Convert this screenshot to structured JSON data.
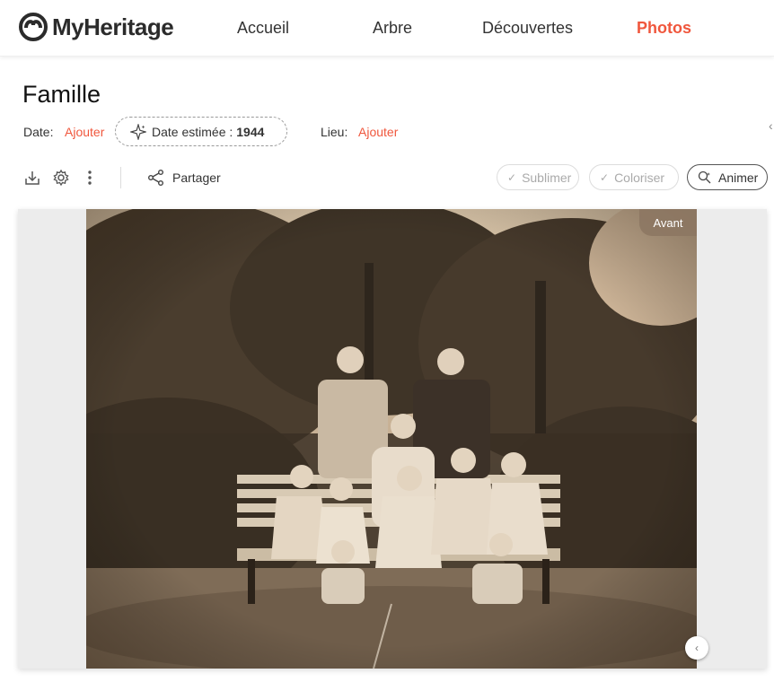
{
  "header": {
    "brand": "MyHeritage",
    "nav": [
      {
        "label": "Accueil",
        "active": false
      },
      {
        "label": "Arbre",
        "active": false
      },
      {
        "label": "Découvertes",
        "active": false
      },
      {
        "label": "Photos",
        "active": true
      }
    ],
    "accent_color": "#f0573d"
  },
  "photo_info": {
    "title": "Famille",
    "date_label": "Date:",
    "date_action": "Ajouter",
    "estimate_label": "Date estimée :",
    "estimate_value": "1944",
    "place_label": "Lieu:",
    "place_action": "Ajouter"
  },
  "toolbar": {
    "icons": [
      "download-icon",
      "gear-icon",
      "more-vertical-icon"
    ],
    "share_label": "Partager",
    "enhance_label": "Sublimer",
    "colorize_label": "Coloriser",
    "animate_label": "Animer"
  },
  "viewer": {
    "badge_label": "Avant",
    "slider_icon": "chevron-left-icon"
  }
}
